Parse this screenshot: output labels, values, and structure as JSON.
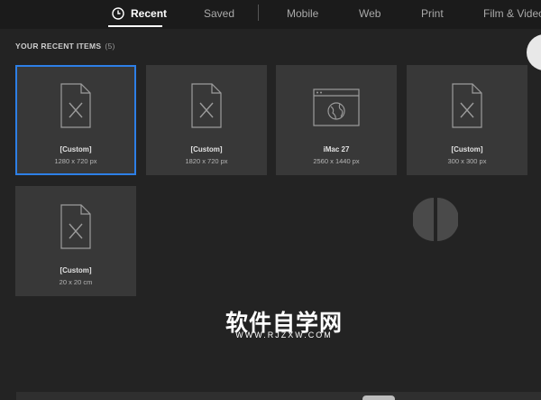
{
  "tabs": [
    {
      "label": "Recent",
      "active": true,
      "icon": "clock-icon"
    },
    {
      "label": "Saved",
      "active": false
    },
    {
      "label": "Mobile",
      "active": false
    },
    {
      "label": "Web",
      "active": false
    },
    {
      "label": "Print",
      "active": false
    },
    {
      "label": "Film & Video",
      "active": false
    }
  ],
  "section": {
    "title": "YOUR RECENT ITEMS",
    "count": "(5)"
  },
  "items": [
    {
      "name": "[Custom]",
      "size": "1280 x 720 px",
      "icon": "document-icon",
      "selected": true
    },
    {
      "name": "[Custom]",
      "size": "1820 x 720 px",
      "icon": "document-icon",
      "selected": false
    },
    {
      "name": "iMac 27",
      "size": "2560 x 1440 px",
      "icon": "web-browser-icon",
      "selected": false
    },
    {
      "name": "[Custom]",
      "size": "300 x 300 px",
      "icon": "document-icon",
      "selected": false
    },
    {
      "name": "[Custom]",
      "size": "20 x 20 cm",
      "icon": "document-icon",
      "selected": false
    }
  ],
  "watermark": {
    "title": "软件自学网",
    "url": "WWW.RJZXW.COM"
  },
  "colors": {
    "background": "#232323",
    "topbar": "#1b1b1b",
    "card": "#383838",
    "selected_border": "#2d7fe6"
  }
}
